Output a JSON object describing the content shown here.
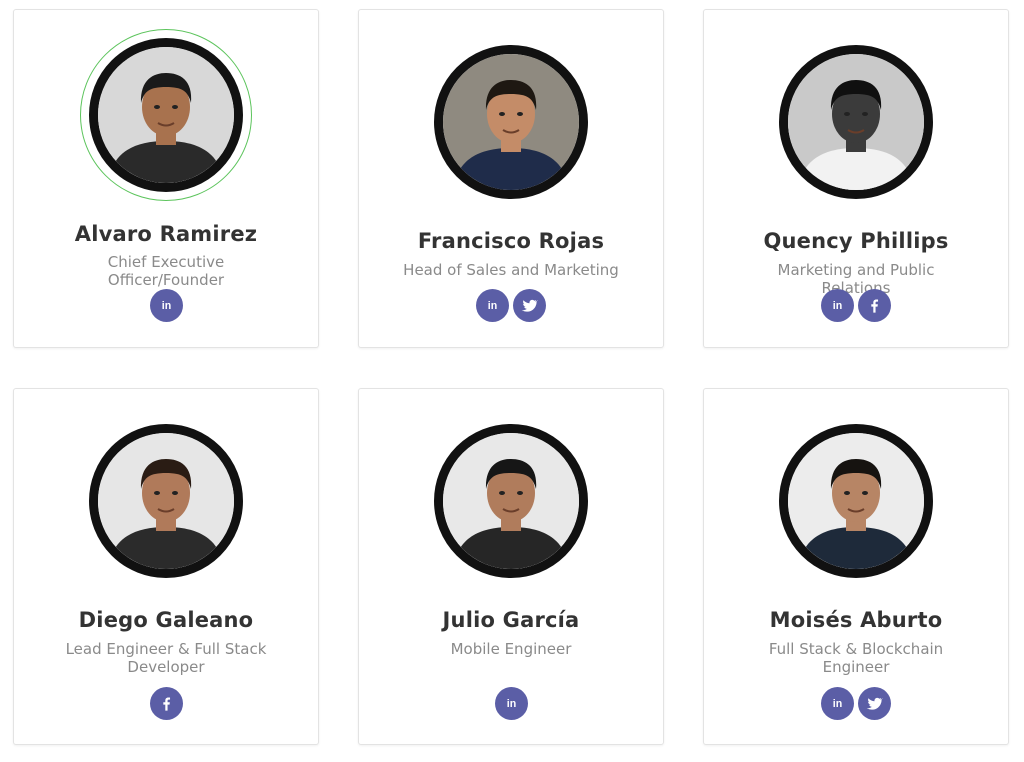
{
  "team": [
    {
      "name": "Alvaro Ramirez",
      "role": "Chief Executive Officer/Founder",
      "socials": [
        "linkedin-icon"
      ],
      "photo": {
        "bg": "#d8d8d8",
        "skin": "#a8724e",
        "hair": "#1a1a1a",
        "shirt": "#2a2a2a"
      }
    },
    {
      "name": "Francisco Rojas",
      "role": "Head of Sales and Marketing",
      "socials": [
        "linkedin-icon",
        "twitter-icon"
      ],
      "photo": {
        "bg": "#8f8a80",
        "skin": "#c48c68",
        "hair": "#1e1812",
        "shirt": "#1f2c4a"
      }
    },
    {
      "name": "Quency Phillips",
      "role": "Marketing and Public Relations",
      "socials": [
        "linkedin-icon",
        "facebook-icon"
      ],
      "photo": {
        "bg": "#c9c9c9",
        "skin": "#3b3b3b",
        "hair": "#101010",
        "shirt": "#f2f2f2"
      }
    },
    {
      "name": "Diego Galeano",
      "role": "Lead Engineer & Full Stack Developer",
      "socials": [
        "facebook-icon"
      ],
      "photo": {
        "bg": "#e6e6e6",
        "skin": "#b07a5a",
        "hair": "#2a1c14",
        "shirt": "#2b2b2b"
      }
    },
    {
      "name": "Julio García",
      "role": "Mobile Engineer",
      "socials": [
        "linkedin-icon"
      ],
      "photo": {
        "bg": "#e8e8e8",
        "skin": "#b07c5c",
        "hair": "#161616",
        "shirt": "#262626"
      }
    },
    {
      "name": "Moisés Aburto",
      "role": "Full Stack & Blockchain Engineer",
      "socials": [
        "linkedin-icon",
        "twitter-icon"
      ],
      "photo": {
        "bg": "#ececec",
        "skin": "#b78565",
        "hair": "#161310",
        "shirt": "#1e2a3a"
      }
    }
  ],
  "colors": {
    "social_bg": "#5b5ea6",
    "hover_ring": "#5cc45c",
    "name": "#333333",
    "role": "#8a8a8a"
  }
}
